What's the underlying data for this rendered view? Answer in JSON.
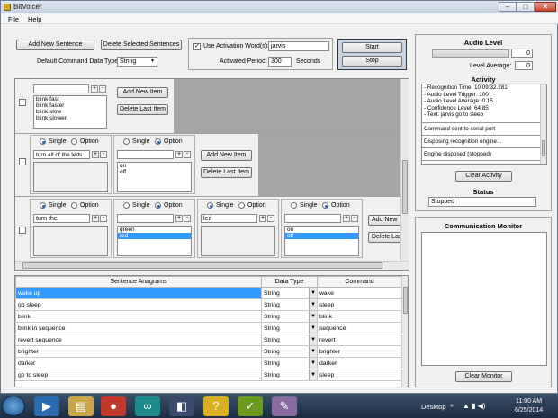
{
  "window": {
    "title": "BitVoicer"
  },
  "menu": [
    "File",
    "Help"
  ],
  "toolbar": {
    "add_new_sentence": "Add New Sentence",
    "delete_selected": "Delete Selected Sentences",
    "default_type_label": "Default Command Data Type:",
    "default_type_value": "String"
  },
  "activation": {
    "checkbox_label": "Use Activation Word(s):",
    "word": "jarvis",
    "period_label": "Activated Period:",
    "period_value": "300",
    "seconds": "Seconds"
  },
  "startstop": {
    "start": "Start",
    "stop": "Stop"
  },
  "sentence_panels": {
    "p1": {
      "items": [
        "blink fast",
        "blink faster",
        "blink slow",
        "blink slower"
      ],
      "add_item": "Add New Item",
      "delete_item": "Delete Last Item"
    },
    "p2": {
      "single": "Single",
      "option": "Option",
      "seg1_text": "turn all of the leds",
      "seg2_items": [
        "on",
        "off"
      ],
      "add_item": "Add New Item",
      "delete_item": "Delete Last Item"
    },
    "p3": {
      "single": "Single",
      "option": "Option",
      "seg1_text": "turn the",
      "seg2_items": [
        "green",
        "red"
      ],
      "seg3_text": "led",
      "seg4_items": [
        "on",
        "off"
      ],
      "add_new": "Add New",
      "delete_last": "Delete Las"
    }
  },
  "anagrams": {
    "headers": [
      "Sentence Anagrams",
      "Data Type",
      "Command"
    ],
    "rows": [
      {
        "sentence": "wake up",
        "type": "String",
        "command": "wake",
        "selected": true
      },
      {
        "sentence": "go sleep",
        "type": "String",
        "command": "sleep"
      },
      {
        "sentence": "blink",
        "type": "String",
        "command": "blink"
      },
      {
        "sentence": "blink in sequence",
        "type": "String",
        "command": "sequence"
      },
      {
        "sentence": "revert sequence",
        "type": "String",
        "command": "revert"
      },
      {
        "sentence": "brighter",
        "type": "String",
        "command": "brighter"
      },
      {
        "sentence": "darker",
        "type": "String",
        "command": "darker"
      },
      {
        "sentence": "go to sleep",
        "type": "String",
        "command": "sleep"
      }
    ]
  },
  "audio": {
    "title": "Audio Level",
    "level_value": "0",
    "average_label": "Level Average:",
    "average_value": "0"
  },
  "activity": {
    "title": "Activity",
    "lines": [
      "- Recognition Time: 10:09:32.281",
      "- Audio Level Trigger: 100",
      "- Audio Level Average: 0.15",
      "- Confidence Level: 64.85",
      "- Text: jarvis go to sleep"
    ],
    "entries": [
      "Command sent to serial port",
      "Disposing recognition engine...",
      "Engine disposed (stopped)"
    ],
    "clear": "Clear Activity"
  },
  "status": {
    "title": "Status",
    "value": "Stopped"
  },
  "monitor": {
    "title": "Communication Monitor",
    "clear": "Clear Monitor"
  },
  "taskbar": {
    "desktop": "Desktop",
    "time": "11:00 AM",
    "date": "6/25/2014"
  }
}
